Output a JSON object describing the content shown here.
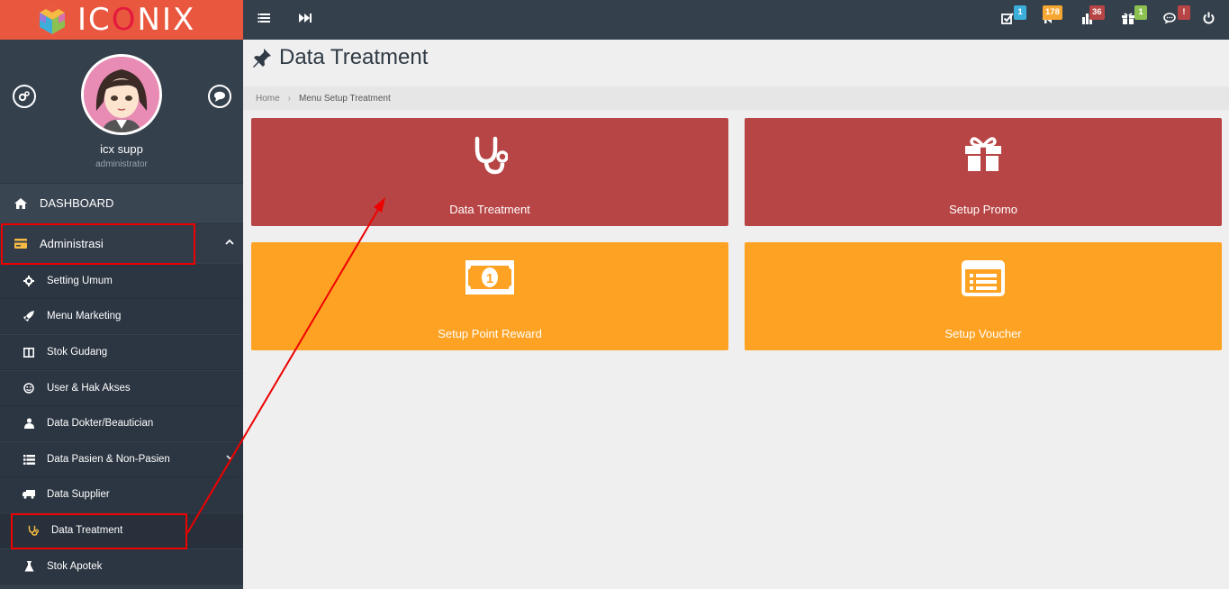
{
  "brand": {
    "logo_prefix": "IC",
    "logo_o": "O",
    "logo_suffix": "NIX"
  },
  "profile": {
    "name": "icx supp",
    "role": "administrator"
  },
  "topbar": {
    "badges": [
      {
        "icon": "tasks-icon",
        "count": "1",
        "color": "#3bafda"
      },
      {
        "icon": "megaphone-icon",
        "count": "178",
        "color": "#f6a732"
      },
      {
        "icon": "bar-chart-icon",
        "count": "36",
        "color": "#b84545"
      },
      {
        "icon": "gift-icon",
        "count": "1",
        "color": "#8cc152"
      },
      {
        "icon": "comment-icon",
        "count": "!",
        "color": "#b84545"
      }
    ]
  },
  "nav": {
    "dashboard": "DASHBOARD",
    "administrasi": "Administrasi",
    "items": [
      "Setting Umum",
      "Menu Marketing",
      "Stok Gudang",
      "User & Hak Akses",
      "Data Dokter/Beautician",
      "Data Pasien & Non-Pasien",
      "Data Supplier",
      "Data Treatment",
      "Stok Apotek"
    ]
  },
  "page": {
    "title": "Data Treatment",
    "breadcrumb": {
      "home": "Home",
      "current": "Menu Setup Treatment"
    }
  },
  "tiles": [
    {
      "label": "Data Treatment",
      "color": "#b84545",
      "icon": "stethoscope-icon"
    },
    {
      "label": "Setup Promo",
      "color": "#b84545",
      "icon": "gift-icon"
    },
    {
      "label": "Setup Point Reward",
      "color": "#fea223",
      "icon": "money-icon"
    },
    {
      "label": "Setup Voucher",
      "color": "#fea223",
      "icon": "list-alt-icon"
    }
  ]
}
